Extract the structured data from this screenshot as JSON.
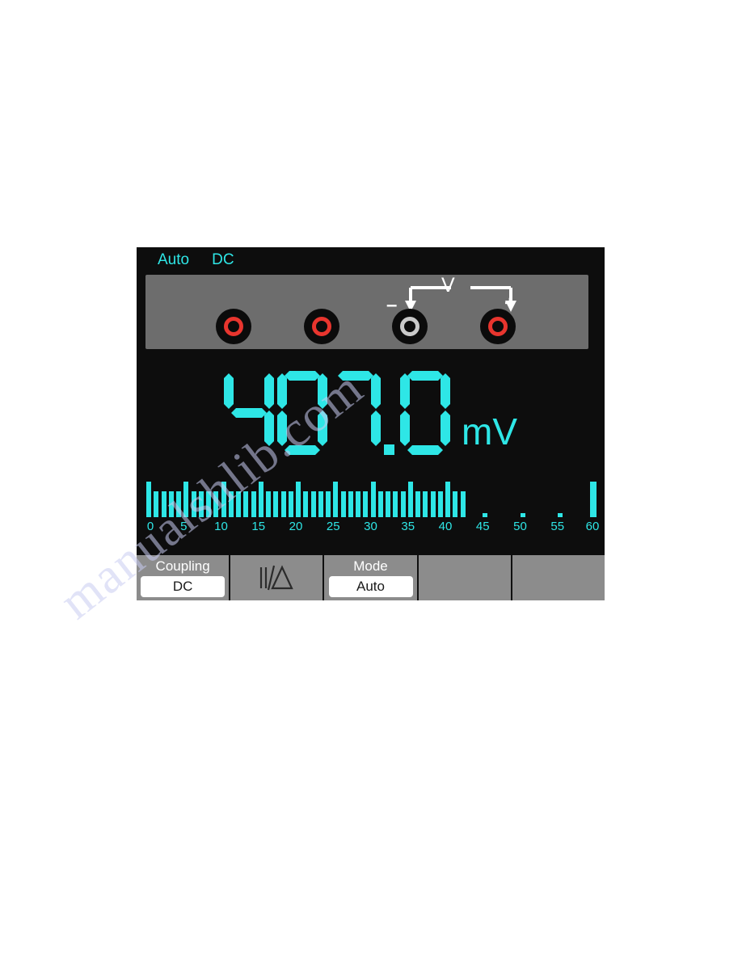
{
  "device": {
    "screen_background": "#0d0d0d",
    "accent_color": "#2ee6e6",
    "panel_color": "#6d6d6d",
    "menu_color": "#8c8c8c"
  },
  "status_bar": {
    "items": [
      {
        "label": "Auto",
        "name": "status-range-mode"
      },
      {
        "label": "DC",
        "name": "status-coupling"
      }
    ]
  },
  "terminal_panel": {
    "jacks": [
      {
        "name": "jack-1",
        "ring_color": "#e8352e",
        "label": ""
      },
      {
        "name": "jack-2",
        "ring_color": "#e8352e",
        "label": ""
      },
      {
        "name": "jack-3",
        "ring_color": "#c9c9c9",
        "label": "-"
      },
      {
        "name": "jack-4",
        "ring_color": "#e8352e",
        "label": "+"
      }
    ],
    "hookup": {
      "measurement_symbol": "V",
      "negative_sign": "–",
      "positive_sign": "+"
    }
  },
  "reading": {
    "value_text": "407.0",
    "digits": [
      "4",
      "0",
      "7",
      ".",
      "0"
    ],
    "unit": "mV",
    "negative": false
  },
  "bargraph": {
    "min": 0,
    "max": 60,
    "value": 42,
    "tick_labels": [
      "0",
      "5",
      "10",
      "15",
      "20",
      "25",
      "30",
      "35",
      "40",
      "45",
      "50",
      "55",
      "60"
    ],
    "tick_values": [
      0,
      5,
      10,
      15,
      20,
      25,
      30,
      35,
      40,
      45,
      50,
      55,
      60
    ],
    "segment_count": 60,
    "end_marker": true
  },
  "menu": {
    "cells": [
      {
        "name": "menu-coupling",
        "title": "Coupling",
        "value": "DC",
        "icon": ""
      },
      {
        "name": "menu-relative",
        "title": "",
        "value": "",
        "icon": "relative-delta-icon"
      },
      {
        "name": "menu-mode",
        "title": "Mode",
        "value": "Auto",
        "icon": ""
      },
      {
        "name": "menu-empty-1",
        "title": "",
        "value": "",
        "icon": ""
      },
      {
        "name": "menu-empty-2",
        "title": "",
        "value": "",
        "icon": ""
      }
    ]
  },
  "watermark": {
    "text": "manualshlib.com"
  }
}
